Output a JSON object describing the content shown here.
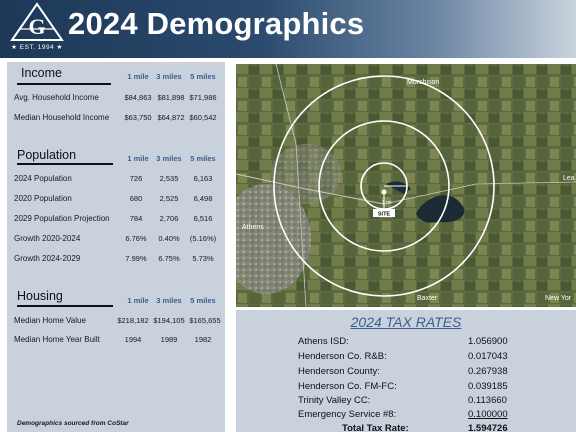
{
  "header": {
    "title": "2024 Demographics",
    "logo_est": "★ EST. 1994 ★",
    "logo_letters": "AGC"
  },
  "radius_headers": [
    "1 mile",
    "3 miles",
    "5 miles"
  ],
  "income": {
    "title": "Income",
    "rows": [
      {
        "label": "Avg. Household Income",
        "values": [
          "$84,863",
          "$81,898",
          "$71,986"
        ]
      },
      {
        "label": "Median Household Income",
        "values": [
          "$63,750",
          "$64,872",
          "$60,542"
        ]
      }
    ]
  },
  "population": {
    "title": "Population",
    "rows": [
      {
        "label": "2024 Population",
        "values": [
          "726",
          "2,535",
          "6,163"
        ]
      },
      {
        "label": "2020 Population",
        "values": [
          "680",
          "2,525",
          "6,498"
        ]
      },
      {
        "label": "2029 Population Projection",
        "values": [
          "784",
          "2,706",
          "6,516"
        ]
      },
      {
        "label": "Growth 2020-2024",
        "values": [
          "6.76%",
          "0.40%",
          "(5.16%)"
        ]
      },
      {
        "label": "Growth 2024-2029",
        "values": [
          "7.99%",
          "6.75%",
          "5.73%"
        ]
      }
    ]
  },
  "housing": {
    "title": "Housing",
    "rows": [
      {
        "label": "Median Home Value",
        "values": [
          "$218,182",
          "$194,105",
          "$165,655"
        ]
      },
      {
        "label": "Median Home Year Built",
        "values": [
          "1994",
          "1989",
          "1982"
        ]
      }
    ]
  },
  "footnote": "Demographics sourced from CoStar",
  "map": {
    "site_label": "SITE",
    "place_labels": [
      "Murchison",
      "Athens",
      "Baxter",
      "New Yor",
      "Lea",
      "1 mi"
    ]
  },
  "tax": {
    "title": "2024 TAX RATES",
    "rows": [
      {
        "label": "Athens ISD:",
        "value": "1.056900"
      },
      {
        "label": "Henderson Co. R&B:",
        "value": "0.017043"
      },
      {
        "label": "Henderson County:",
        "value": "0.267938"
      },
      {
        "label": "Henderson Co. FM-FC:",
        "value": "0.039185"
      },
      {
        "label": "Trinity Valley CC:",
        "value": "0.113660"
      },
      {
        "label": "Emergency Service #8:",
        "value": "0.100000"
      }
    ],
    "total_label": "Total Tax Rate:",
    "total_value": "1.594726"
  },
  "colors": {
    "header_dark": "#1d3857",
    "panel_bg": "#c9d1dc",
    "accent_blue": "#3a5f8c"
  }
}
